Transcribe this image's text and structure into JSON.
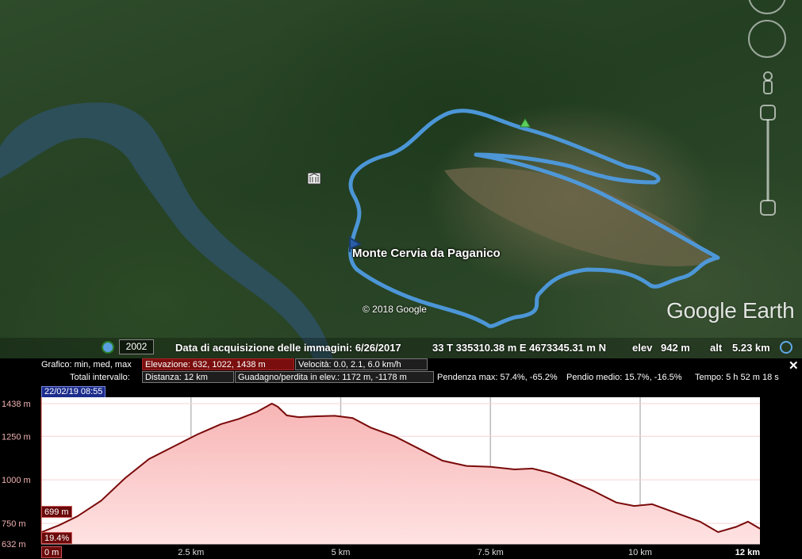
{
  "map": {
    "title": "Monte Cervia da Paganico",
    "copyright": "© 2018 Google",
    "logo": "Google Earth",
    "track_color": "#4e9be0"
  },
  "statusbar": {
    "year": "2002",
    "acquisition": "Data di acquisizione delle immagini: 6/26/2017",
    "coords": "33 T 335310.38 m E 4673345.31 m N",
    "elev_label": "elev",
    "elev_value": "942 m",
    "alt_label": "alt",
    "alt_value": "5.23 km"
  },
  "panel": {
    "graph_label": "Grafico: min, med, max",
    "elevation": "Elevazione: 632, 1022, 1438 m",
    "speed": "Velocità: 0.0, 2.1, 6.0 km/h",
    "totals_label": "Totali intervallo:",
    "distance": "Distanza: 12 km",
    "gain_loss": "Guadagno/perdita in elev.: 1172 m, -1178 m",
    "max_slope": "Pendenza max: 57.4%, -65.2%",
    "avg_slope": "Pendio medio: 15.7%, -16.5%",
    "time": "Tempo: 5 h 52 m 18 s",
    "date": "22/02/19 08:55",
    "cursor_elev": "699 m",
    "cursor_slope": "19.4%",
    "cursor_dist": "0 m",
    "close": "✕"
  },
  "chart_data": {
    "type": "area",
    "xlabel": "",
    "ylabel": "",
    "x_unit": "km",
    "xlim": [
      0,
      12
    ],
    "ylim": [
      632,
      1438
    ],
    "y_ticks": [
      "1438 m",
      "1250 m",
      "1000 m",
      "750 m",
      "632 m"
    ],
    "y_tick_values": [
      1438,
      1250,
      1000,
      750,
      632
    ],
    "x_ticks": [
      "2.5 km",
      "5 km",
      "7.5 km",
      "10 km"
    ],
    "x_tick_values": [
      2.5,
      5,
      7.5,
      10
    ],
    "x_end_label": "12 km",
    "line_color": "#7a0a0a",
    "fill_top": "#ffe2e2",
    "fill_bottom": "#f7b5b5",
    "x": [
      0,
      0.3,
      0.6,
      1.0,
      1.4,
      1.8,
      2.2,
      2.6,
      3.0,
      3.3,
      3.6,
      3.85,
      3.95,
      4.1,
      4.3,
      4.6,
      4.9,
      5.2,
      5.5,
      5.9,
      6.3,
      6.7,
      7.1,
      7.5,
      7.9,
      8.2,
      8.5,
      8.8,
      9.2,
      9.6,
      9.9,
      10.2,
      10.6,
      11.0,
      11.3,
      11.6,
      11.8,
      12.0
    ],
    "y": [
      699,
      740,
      790,
      880,
      1010,
      1120,
      1190,
      1260,
      1320,
      1350,
      1390,
      1438,
      1420,
      1370,
      1360,
      1365,
      1368,
      1355,
      1300,
      1250,
      1180,
      1110,
      1080,
      1075,
      1060,
      1065,
      1040,
      1000,
      940,
      870,
      850,
      860,
      810,
      760,
      700,
      730,
      760,
      720
    ]
  }
}
